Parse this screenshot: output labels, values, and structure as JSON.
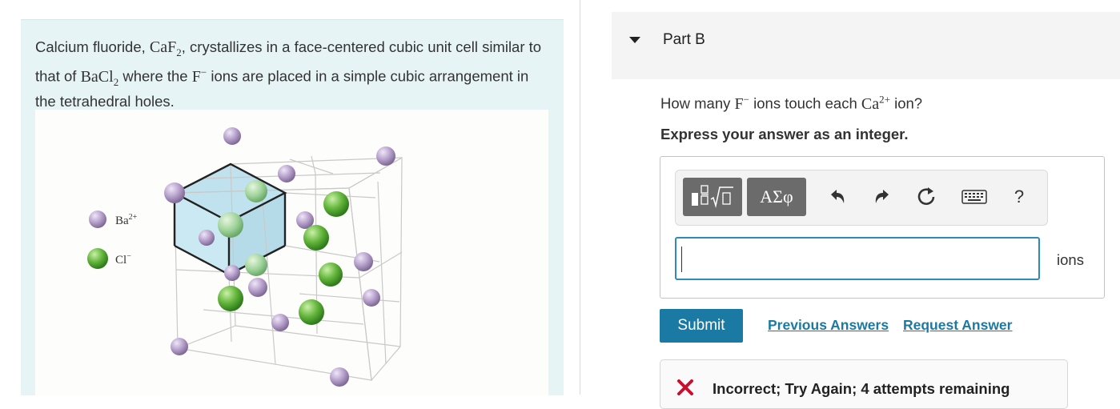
{
  "problem": {
    "text_1": "Calcium fluoride, ",
    "formula_CaF2_base": "CaF",
    "formula_CaF2_sub": "2",
    "text_2": ", crystallizes in a face-centered cubic unit cell similar to that of ",
    "formula_BaCl2_base": "BaCl",
    "formula_BaCl2_sub": "2",
    "text_3": " where the ",
    "ion_F": "F",
    "ion_F_charge": "−",
    "text_4": " ions are placed in a simple cubic arrangement in the tetrahedral holes.",
    "legend": {
      "ba_label": "Ba",
      "ba_charge": "2+",
      "cl_label": "Cl",
      "cl_charge": "−"
    },
    "colors": {
      "ba_sphere": "#b7a1cc",
      "cl_sphere": "#63b53a",
      "cube_fill": "#a9d8ea"
    }
  },
  "part": {
    "title": "Part B",
    "question_1": "How many ",
    "question_ion_F": "F",
    "question_ion_F_charge": "−",
    "question_2": " ions touch each ",
    "question_ion_Ca": "Ca",
    "question_ion_Ca_charge": "2+",
    "question_3": " ion?",
    "instruction": "Express your answer as an integer."
  },
  "toolbar": {
    "template_icon": "fraction-radical-template-icon",
    "greek_label": "ΑΣφ",
    "undo_icon": "undo-icon",
    "redo_icon": "redo-icon",
    "reset_icon": "reset-icon",
    "keyboard_icon": "keyboard-icon",
    "help_label": "?"
  },
  "answer": {
    "value": "",
    "units": "ions"
  },
  "actions": {
    "submit_label": "Submit",
    "previous_answers_label": "Previous Answers",
    "request_answer_label": "Request Answer"
  },
  "feedback": {
    "text": "Incorrect; Try Again; 4 attempts remaining",
    "color": "#c8102e"
  },
  "accent": "#1b7aa3"
}
